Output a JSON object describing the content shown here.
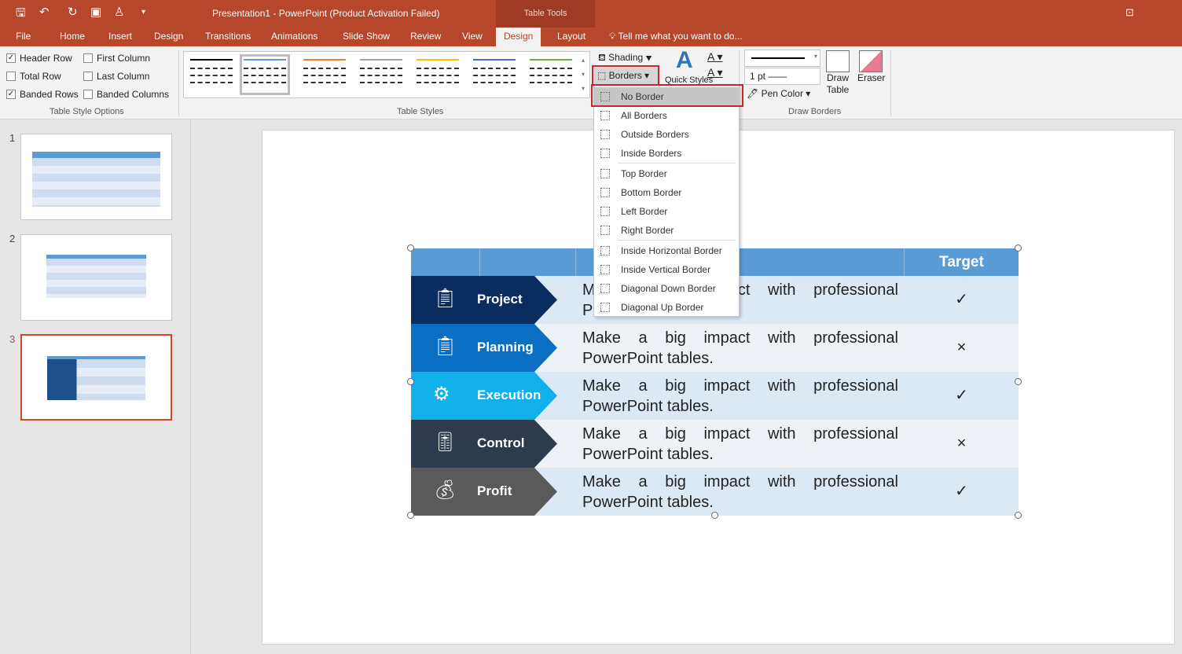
{
  "window": {
    "title": "Presentation1 - PowerPoint (Product Activation Failed)",
    "context_tab": "Table Tools"
  },
  "quick_access": [
    "save-icon",
    "undo-icon",
    "redo-icon",
    "present-icon",
    "brush-icon",
    "customize-icon"
  ],
  "tabs": [
    "File",
    "Home",
    "Insert",
    "Design",
    "Transitions",
    "Animations",
    "Slide Show",
    "Review",
    "View",
    "Design",
    "Layout"
  ],
  "active_tab": "Design",
  "tell_me": "Tell me what you want to do...",
  "table_style_options": {
    "items": [
      {
        "label": "Header Row",
        "checked": true
      },
      {
        "label": "First Column",
        "checked": false
      },
      {
        "label": "Total Row",
        "checked": false
      },
      {
        "label": "Last Column",
        "checked": false
      },
      {
        "label": "Banded Rows",
        "checked": true
      },
      {
        "label": "Banded Columns",
        "checked": false
      }
    ],
    "group": "Table Style Options"
  },
  "table_styles": {
    "group": "Table Styles",
    "swatches": [
      "#000000",
      "#5b9bd5",
      "#ed7d31",
      "#a5a5a5",
      "#ffc000",
      "#4472c4",
      "#70ad47"
    ]
  },
  "shading": "Shading",
  "borders": "Borders",
  "quick_styles": "Quick Styles",
  "draw_borders": {
    "pen_weight": "1 pt",
    "pen_color": "Pen Color",
    "draw_table": "Draw Table",
    "eraser": "Eraser",
    "group": "Draw Borders"
  },
  "border_menu": [
    "No Border",
    "All Borders",
    "Outside Borders",
    "Inside Borders",
    "Top Border",
    "Bottom Border",
    "Left Border",
    "Right Border",
    "Inside Horizontal Border",
    "Inside Vertical Border",
    "Diagonal Down Border",
    "Diagonal Up Border"
  ],
  "slides": [
    "1",
    "2",
    "3"
  ],
  "table": {
    "header_target": "Target",
    "rows": [
      {
        "label": "Project",
        "text": "Make a big impact with professional PowerPoint tables.",
        "target": "✓",
        "color": "#0b2c5e",
        "bg": "#dde8f5"
      },
      {
        "label": "Planning",
        "text": "Make a big impact with professional PowerPoint tables.",
        "target": "×",
        "color": "#0a6fc2",
        "bg": "#eef1f5"
      },
      {
        "label": "Execution",
        "text": "Make a big impact with professional PowerPoint tables.",
        "target": "✓",
        "color": "#11b0ea",
        "bg": "#dde8f5"
      },
      {
        "label": "Control",
        "text": "Make a big impact with professional PowerPoint tables.",
        "target": "×",
        "color": "#2e3a4e",
        "bg": "#eef1f5"
      },
      {
        "label": "Profit",
        "text": "Make a big impact with professional PowerPoint tables.",
        "target": "✓",
        "color": "#5a5a5a",
        "bg": "#dde8f5"
      }
    ]
  }
}
